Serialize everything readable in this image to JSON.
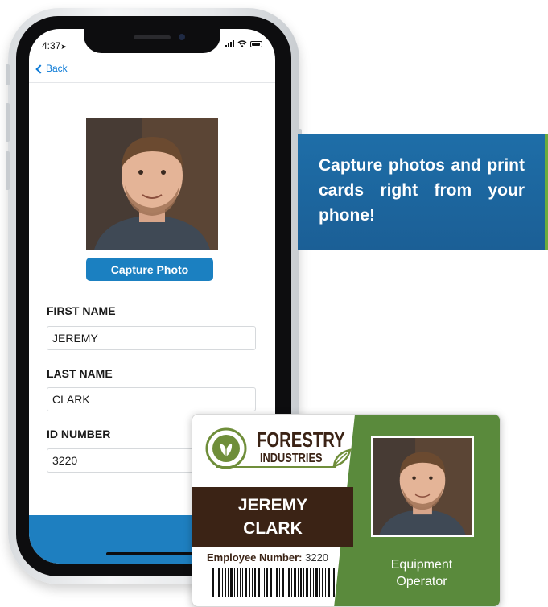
{
  "phone": {
    "status_time": "4:37",
    "back_label": "Back",
    "capture_button": "Capture Photo",
    "fields": [
      {
        "label": "FIRST NAME",
        "value": "JEREMY"
      },
      {
        "label": "LAST NAME",
        "value": "CLARK"
      },
      {
        "label": "ID NUMBER",
        "value": "3220"
      }
    ]
  },
  "promo": {
    "text": "Capture photos and print cards right from your phone!"
  },
  "card": {
    "brand_line1": "FORESTRY",
    "brand_line2": "INDUSTRIES",
    "first_name": "JEREMY",
    "last_name": "CLARK",
    "employee_label": "Employee Number:",
    "employee_number": "3220",
    "job_line1": "Equipment",
    "job_line2": "Operator"
  },
  "colors": {
    "accent_blue": "#1b80c1",
    "promo_blue": "#1e6ea8",
    "brand_green": "#5a8a3c",
    "brand_brown": "#3b2315"
  }
}
